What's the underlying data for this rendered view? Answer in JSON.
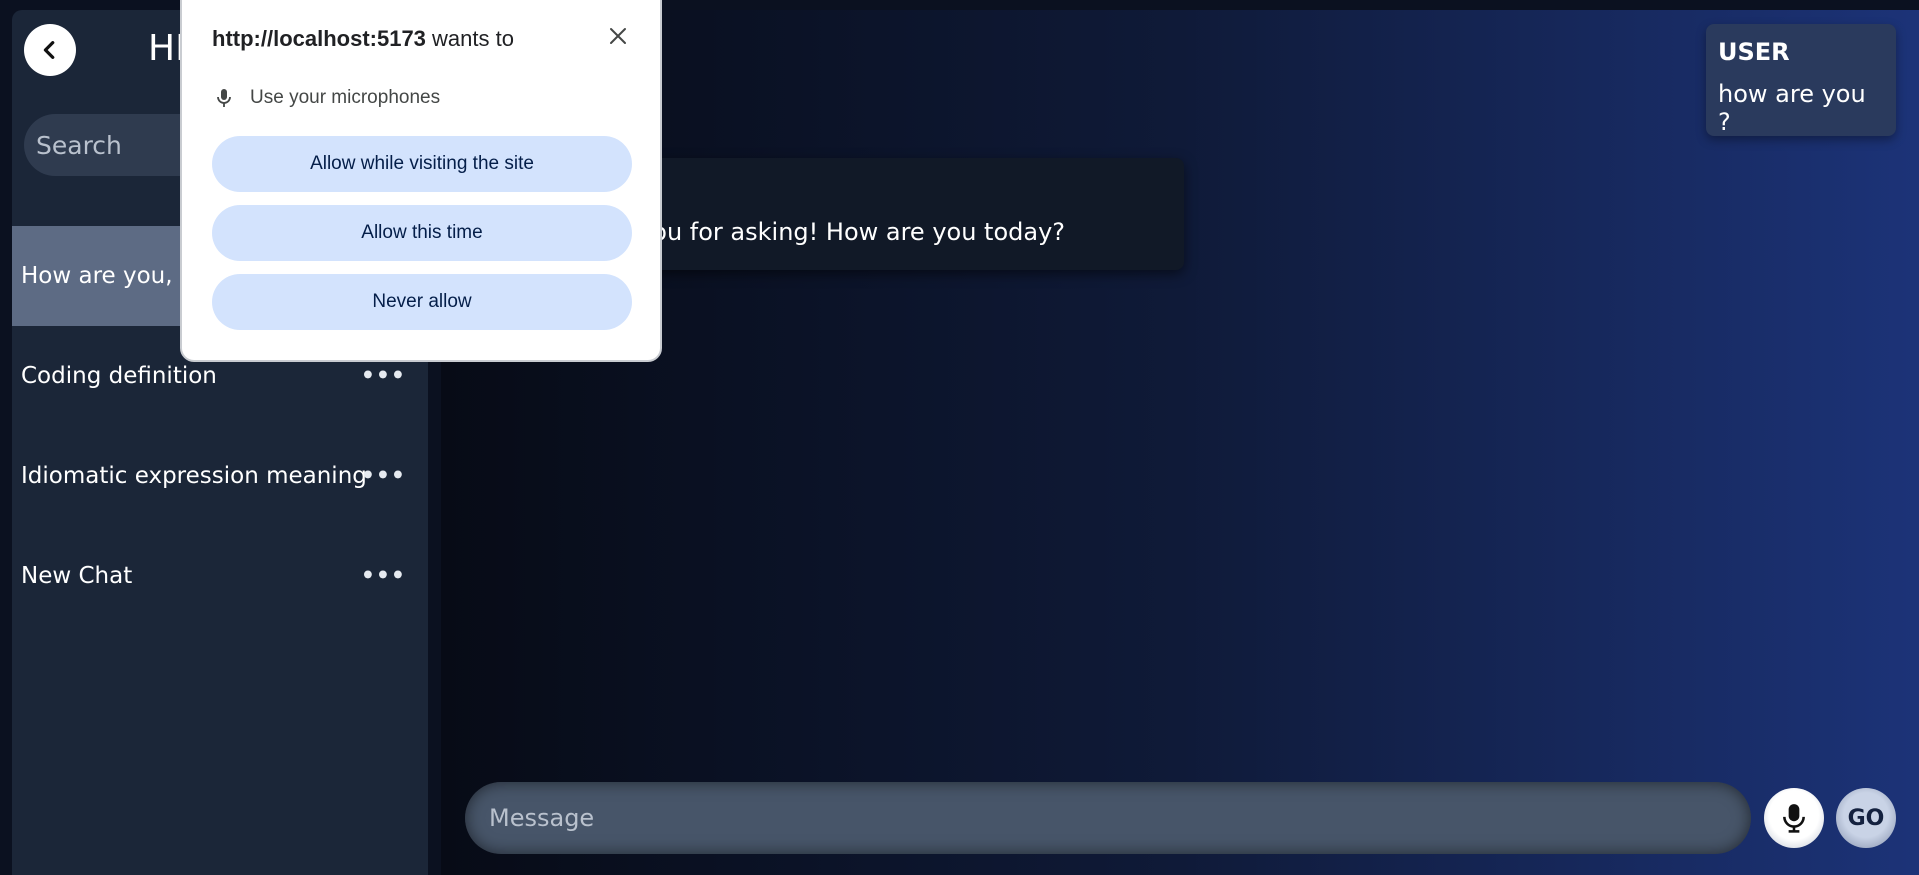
{
  "sidebar": {
    "title": "HI",
    "search_placeholder": "Search",
    "chats": [
      {
        "label": "How are you, A",
        "active": true
      },
      {
        "label": "Coding definition",
        "active": false
      },
      {
        "label": "Idiomatic expression meaning",
        "active": false
      },
      {
        "label": "New Chat",
        "active": false
      }
    ],
    "more_label": "•••"
  },
  "conversation": {
    "user": {
      "role": "USER",
      "text": "how are you ?"
    },
    "assistant": {
      "text": "thank you for asking!  How are you today?"
    }
  },
  "composer": {
    "placeholder": "Message",
    "go_label": "GO"
  },
  "permission_popup": {
    "host": "http://localhost:5173",
    "wants_to": "wants to",
    "permission": "Use your microphones",
    "buttons": {
      "allow_while_visiting": "Allow while visiting the site",
      "allow_this_time": "Allow this time",
      "never_allow": "Never allow"
    }
  },
  "icons": {
    "back": "chevron-left-icon",
    "mic": "microphone-icon",
    "close": "close-icon",
    "more": "more-horizontal-icon"
  },
  "colors": {
    "sidebar_bg": "#1b2638",
    "active_chat_bg": "#5d6b84",
    "popup_button_bg": "#d3e3fd",
    "user_bubble_bg": "#2a3a5d"
  }
}
